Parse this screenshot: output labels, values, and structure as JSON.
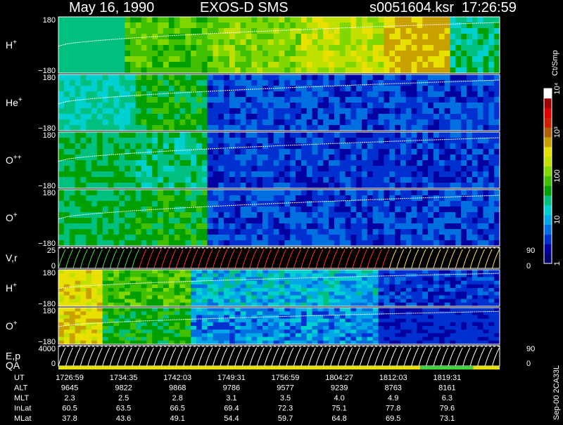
{
  "header": {
    "date": "May 16, 1990",
    "instrument": "EXOS-D SMS",
    "file": "s0051604.ksr",
    "time": "17:26:59"
  },
  "footer_note": "Sep-00 2CA33L",
  "colorbar": {
    "title": "Ct/Smp",
    "labels": [
      {
        "text": "1",
        "value": 1
      },
      {
        "text": "10",
        "value": 10
      },
      {
        "text": "100",
        "value": 100
      },
      {
        "text": "10³",
        "value": 1000
      },
      {
        "text": "10⁴",
        "value": 10000
      }
    ],
    "colors": [
      "#000070",
      "#0000a0",
      "#0030d0",
      "#0070e0",
      "#00a8e8",
      "#00d0d0",
      "#00c080",
      "#00a000",
      "#40c000",
      "#80d800",
      "#c0e000",
      "#e8e000",
      "#c8a000",
      "#b06000",
      "#d02000",
      "#e00000",
      "#a00000",
      "#ffffff"
    ]
  },
  "panels": [
    {
      "id": "h-plus-1",
      "label": "H+",
      "label_base": "H",
      "label_sup": "+",
      "ymax": "180",
      "ymin": "−180"
    },
    {
      "id": "he-plus",
      "label": "He+",
      "label_base": "He",
      "label_sup": "+",
      "ymax": "180",
      "ymin": "−180"
    },
    {
      "id": "o-plusplus",
      "label": "O++",
      "label_base": "O",
      "label_sup": "++",
      "ymax": "180",
      "ymin": "−180"
    },
    {
      "id": "o-plus-1",
      "label": "O+",
      "label_base": "O",
      "label_sup": "+",
      "ymax": "180",
      "ymin": "−180"
    },
    {
      "id": "vr",
      "label": "V,r",
      "label_base": "V,r",
      "label_sup": "",
      "ymax": "25",
      "ymin": "0",
      "rmax": "90",
      "rmin": "0"
    },
    {
      "id": "h-plus-2",
      "label": "H+",
      "label_base": "H",
      "label_sup": "+",
      "ymax": "180",
      "ymin": "−180"
    },
    {
      "id": "o-plus-2",
      "label": "O+",
      "label_base": "O",
      "label_sup": "+",
      "ymax": "180",
      "ymin": "−180"
    },
    {
      "id": "ep",
      "label": "E,p",
      "label_base": "E,p",
      "label_sup": "",
      "ymax": "4000",
      "ymin": "0",
      "rmax": "90",
      "rmin": "0"
    }
  ],
  "qa_label": "QA",
  "table": {
    "rows": [
      {
        "name": "UT",
        "values": [
          "1726:59",
          "1734:35",
          "1742:03",
          "1749:31",
          "1756:59",
          "1804:27",
          "1812:03",
          "1819:31"
        ]
      },
      {
        "name": "ALT",
        "values": [
          "9645",
          "9822",
          "9868",
          "9786",
          "9577",
          "9239",
          "8763",
          "8161"
        ]
      },
      {
        "name": "MLT",
        "values": [
          "2.3",
          "2.5",
          "2.8",
          "3.1",
          "3.5",
          "4.0",
          "4.9",
          "6.3"
        ]
      },
      {
        "name": "InLat",
        "values": [
          "60.5",
          "63.5",
          "66.5",
          "69.4",
          "72.3",
          "75.1",
          "77.8",
          "79.6"
        ]
      },
      {
        "name": "MLat",
        "values": [
          "37.8",
          "43.6",
          "49.1",
          "54.4",
          "59.7",
          "64.8",
          "69.5",
          "73.1"
        ]
      }
    ]
  },
  "chart_data": {
    "type": "heatmap",
    "title": "May 16, 1990   EXOS-D SMS",
    "x_ticks": [
      "1726:59",
      "1734:35",
      "1742:03",
      "1749:31",
      "1756:59",
      "1804:27",
      "1812:03",
      "1819:31"
    ],
    "y_axis_pitch": [
      -180,
      180
    ],
    "y_axis_vr": [
      0,
      25
    ],
    "y_axis_ep": [
      0,
      4000
    ],
    "right_axis_angle": [
      0,
      90
    ],
    "color_scale": "log",
    "color_range": [
      1,
      10000
    ],
    "color_unit": "Ct/Smp",
    "species_panels": [
      "H+",
      "He+",
      "O++",
      "O+",
      "H+",
      "O+"
    ]
  }
}
